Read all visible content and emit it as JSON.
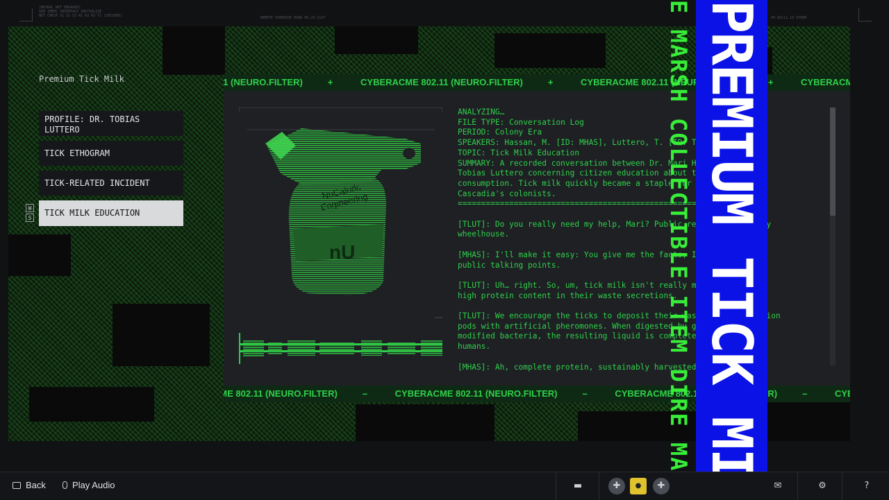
{
  "hud": {
    "top_left_lines": [
      "[NEURAL NET ENGAGED]",
      "GEN [MEM] INTERFACE INITIALIZE",
      "NET CHECK S1 S2 S3 R1 R2 R3 T1  [SECURED]"
    ],
    "top_mid": "REMOTE OVERRIDE BINK 06.29.2137",
    "top_right": "PH.06111.14 STERM"
  },
  "item": {
    "title": "Premium Tick Milk"
  },
  "menu": {
    "items": [
      {
        "label": "PROFILE: DR. TOBIAS LUTTERO"
      },
      {
        "label": "TICK ETHOGRAM"
      },
      {
        "label": "TICK-RELATED INCIDENT"
      },
      {
        "label": "TICK MILK EDUCATION"
      }
    ],
    "key_up": "W",
    "key_down": "S"
  },
  "ticker": {
    "text": "CYBERACME 802.11 (NEURO.FILTER)",
    "sep_top": "+",
    "sep_bottom": "–"
  },
  "viewer": {
    "product_brand_line1": "NuCaloric",
    "product_brand_line2": "Engineering",
    "product_mark": "nU"
  },
  "log": {
    "text": "ANALYZING…\nFILE TYPE: Conversation Log\nPERIOD: Colony Era\nSPEAKERS: Hassan, M. [ID: MHAS], Luttero, T. [ID: TLUT]\nTOPIC: Tick Milk Education\nSUMMARY: A recorded conversation between Dr. Mari Hassan and Dr.\nTobias Luttero concerning citizen education about tick milk\nconsumption. Tick milk quickly became a staple for many of\nCascadia's colonists.\n=================================================================\n\n[TLUT]: Do you really need my help, Mari? Public relations isn't my\nwheelhouse.\n\n[MHAS]: I'll make it easy: You give me the facts, I'll handle the\npublic talking points.\n\n[TLUT]: Uh… right. So, um, tick milk isn't really milk. Ticks have\nhigh protein content in their waste secretions.\n\n[TLUT]: We encourage the ticks to deposit their waste into collection\npods with artificial pheromones. When digested by genetically\nmodified bacteria, the resulting liquid is completely safe for\nhumans.\n\n[MHAS]: Ah, complete protein, sustainably harvested. Perfect.\n\n[TLUT]: Well…"
  },
  "overlay": {
    "green_text": "E MARSH COLLECTIBLE ITEM DIRE MARSH",
    "blue_text": "PREMIUM TICK MILK"
  },
  "bottom": {
    "back_label": "Back",
    "play_audio_label": "Play Audio"
  },
  "colors": {
    "terminal_green": "#2fd14a",
    "overlay_blue": "#0b12e6",
    "overlay_green": "#38ee38"
  }
}
